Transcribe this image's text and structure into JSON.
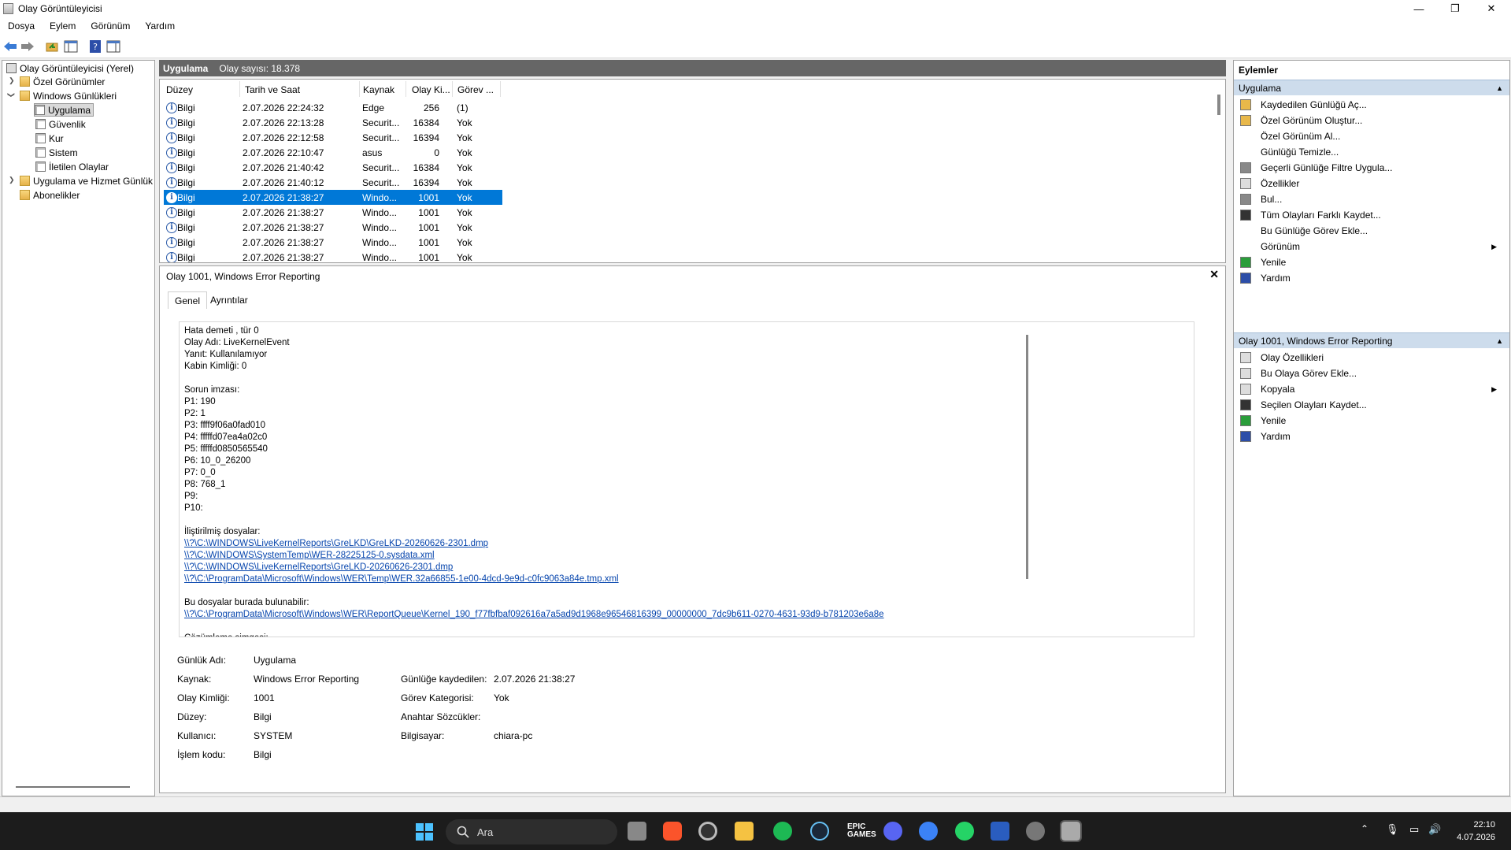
{
  "window": {
    "title": "Olay Görüntüleyicisi",
    "min": "—",
    "max": "❐",
    "close": "✕"
  },
  "menu": [
    "Dosya",
    "Eylem",
    "Görünüm",
    "Yardım"
  ],
  "tree": {
    "root": "Olay Görüntüleyicisi (Yerel)",
    "custom": "Özel Görünümler",
    "winlogs": "Windows Günlükleri",
    "app": "Uygulama",
    "security": "Güvenlik",
    "setup": "Kur",
    "system": "Sistem",
    "forwarded": "İletilen Olaylar",
    "appsvc": "Uygulama ve Hizmet Günlük",
    "subs": "Abonelikler"
  },
  "list": {
    "name": "Uygulama",
    "count": "Olay sayısı: 18.378",
    "headers": [
      "Düzey",
      "Tarih ve Saat",
      "Kaynak",
      "Olay Ki...",
      "Görev ..."
    ],
    "rows": [
      [
        "Bilgi",
        "2.07.2026 22:24:32",
        "Edge",
        "256",
        "(1)"
      ],
      [
        "Bilgi",
        "2.07.2026 22:13:28",
        "Securit...",
        "16384",
        "Yok"
      ],
      [
        "Bilgi",
        "2.07.2026 22:12:58",
        "Securit...",
        "16394",
        "Yok"
      ],
      [
        "Bilgi",
        "2.07.2026 22:10:47",
        "asus",
        "0",
        "Yok"
      ],
      [
        "Bilgi",
        "2.07.2026 21:40:42",
        "Securit...",
        "16384",
        "Yok"
      ],
      [
        "Bilgi",
        "2.07.2026 21:40:12",
        "Securit...",
        "16394",
        "Yok"
      ],
      [
        "Bilgi",
        "2.07.2026 21:38:27",
        "Windo...",
        "1001",
        "Yok"
      ],
      [
        "Bilgi",
        "2.07.2026 21:38:27",
        "Windo...",
        "1001",
        "Yok"
      ],
      [
        "Bilgi",
        "2.07.2026 21:38:27",
        "Windo...",
        "1001",
        "Yok"
      ],
      [
        "Bilgi",
        "2.07.2026 21:38:27",
        "Windo...",
        "1001",
        "Yok"
      ],
      [
        "Bilgi",
        "2.07.2026 21:38:27",
        "Windo...",
        "1001",
        "Yok"
      ]
    ],
    "selected": 6
  },
  "detail": {
    "title": "Olay 1001, Windows Error Reporting",
    "tabs": [
      "Genel",
      "Ayrıntılar"
    ],
    "message": [
      {
        "t": "Hata demeti , tür 0"
      },
      {
        "t": "Olay Adı: LiveKernelEvent"
      },
      {
        "t": "Yanıt: Kullanılamıyor"
      },
      {
        "t": "Kabin Kimliği: 0"
      },
      {
        "t": ""
      },
      {
        "t": "Sorun imzası:"
      },
      {
        "t": "P1: 190"
      },
      {
        "t": "P2: 1"
      },
      {
        "t": "P3: ffff9f06a0fad010"
      },
      {
        "t": "P4: fffffd07ea4a02c0"
      },
      {
        "t": "P5: fffffd0850565540"
      },
      {
        "t": "P6: 10_0_26200"
      },
      {
        "t": "P7: 0_0"
      },
      {
        "t": "P8: 768_1"
      },
      {
        "t": "P9:"
      },
      {
        "t": "P10:"
      },
      {
        "t": ""
      },
      {
        "t": "İliştirilmiş dosyalar:"
      },
      {
        "t": "\\\\?\\C:\\WINDOWS\\LiveKernelReports\\GreLKD\\GreLKD-20260626-2301.dmp",
        "link": true
      },
      {
        "t": "\\\\?\\C:\\WINDOWS\\SystemTemp\\WER-28225125-0.sysdata.xml",
        "link": true
      },
      {
        "t": "\\\\?\\C:\\WINDOWS\\LiveKernelReports\\GreLKD-20260626-2301.dmp",
        "link": true
      },
      {
        "t": "\\\\?\\C:\\ProgramData\\Microsoft\\Windows\\WER\\Temp\\WER.32a66855-1e00-4dcd-9e9d-c0fc9063a84e.tmp.xml",
        "link": true
      },
      {
        "t": ""
      },
      {
        "t": "Bu dosyalar burada bulunabilir:"
      },
      {
        "t": "\\\\?\\C:\\ProgramData\\Microsoft\\Windows\\WER\\ReportQueue\\Kernel_190_f77fbfbaf092616a7a5ad9d1968e96546816399_00000000_7dc9b611-0270-4631-93d9-b781203e6a8e",
        "link": true
      },
      {
        "t": ""
      },
      {
        "t": "Çözümleme simgesi:"
      }
    ],
    "fields": {
      "logname_l": "Günlük Adı:",
      "logname_v": "Uygulama",
      "source_l": "Kaynak:",
      "source_v": "Windows Error Reporting",
      "logged_l": "Günlüğe kaydedilen:",
      "logged_v": "2.07.2026 21:38:27",
      "eventid_l": "Olay Kimliği:",
      "eventid_v": "1001",
      "task_l": "Görev Kategorisi:",
      "task_v": "Yok",
      "level_l": "Düzey:",
      "level_v": "Bilgi",
      "keywords_l": "Anahtar Sözcükler:",
      "user_l": "Kullanıcı:",
      "user_v": "SYSTEM",
      "computer_l": "Bilgisayar:",
      "computer_v": "chiara-pc",
      "opcode_l": "İşlem kodu:",
      "opcode_v": "Bilgi"
    }
  },
  "actions": {
    "title": "Eylemler",
    "sec1": "Uygulama",
    "items1": [
      "Kaydedilen Günlüğü Aç...",
      "Özel Görünüm Oluştur...",
      "Özel Görünüm Al...",
      "Günlüğü Temizle...",
      "Geçerli Günlüğe Filtre Uygula...",
      "Özellikler",
      "Bul...",
      "Tüm Olayları Farklı Kaydet...",
      "Bu Günlüğe Görev Ekle...",
      "Görünüm",
      "Yenile",
      "Yardım"
    ],
    "sec2": "Olay 1001, Windows Error Reporting",
    "items2": [
      "Olay Özellikleri",
      "Bu Olaya Görev Ekle...",
      "Kopyala",
      "Seçilen Olayları Kaydet...",
      "Yenile",
      "Yardım"
    ]
  },
  "taskbar": {
    "search": "Ara",
    "time": "22:10",
    "date": "4.07.2026"
  }
}
